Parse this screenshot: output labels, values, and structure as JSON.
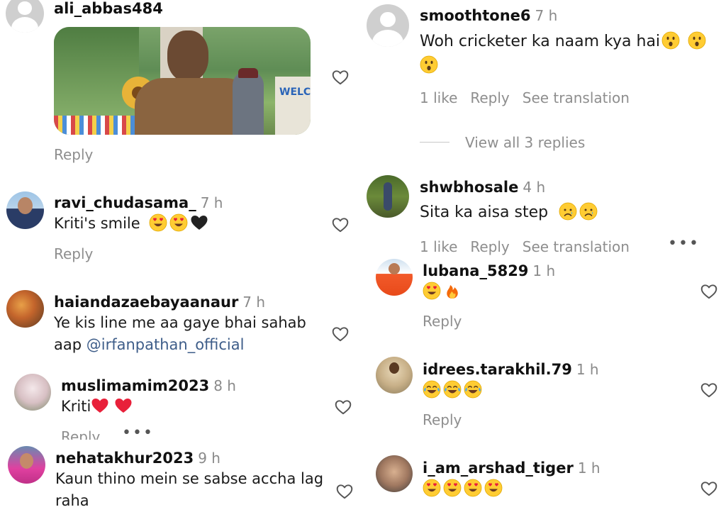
{
  "colors": {
    "username": "#111111",
    "meta": "#8e8e8e",
    "mention": "#3e5d89",
    "background": "#ffffff"
  },
  "left": {
    "c1": {
      "username": "ali_abbas484",
      "reply": "Reply"
    },
    "c2": {
      "username": "ravi_chudasama_",
      "time": "7 h",
      "text": "Kriti's smile",
      "reply": "Reply"
    },
    "c3": {
      "username": "haiandazaebayaanaur",
      "time": "7 h",
      "text_line1": "Ye kis line me aa gaye bhai sahab",
      "text_line2_prefix": "aap ",
      "mention": "@irfanpathan_official"
    },
    "c4": {
      "username": "muslimamim2023",
      "time": "8 h",
      "text": "Kriti",
      "reply": "Reply",
      "more": "•••"
    },
    "c5": {
      "username": "nehatakhur2023",
      "time": "9 h",
      "text_line1": "Kaun thino mein se sabse accha lag",
      "text_line2": "raha"
    }
  },
  "right": {
    "c1": {
      "username": "smoothtone6",
      "time": "7 h",
      "text": "Woh cricketer ka naam kya hai",
      "likes": "1 like",
      "reply": "Reply",
      "translate": "See translation",
      "view_replies": "View all 3 replies"
    },
    "c2": {
      "username": "shwbhosale",
      "time": "4 h",
      "text": "Sita ka aisa step",
      "likes": "1 like",
      "reply": "Reply",
      "translate": "See translation",
      "more": "•••"
    },
    "r1": {
      "username": "lubana_5829",
      "time": "1 h",
      "reply": "Reply"
    },
    "r2": {
      "username": "idrees.tarakhil.79",
      "time": "1 h",
      "reply": "Reply"
    },
    "r3": {
      "username": "i_am_arshad_tiger",
      "time": "1 h"
    }
  },
  "icons": [
    "heart-outline-icon",
    "heart-eyes-emoji",
    "black-heart-emoji",
    "red-heart-emoji",
    "astonished-emoji",
    "sad-emoji",
    "fire-emoji",
    "tears-of-joy-emoji"
  ]
}
